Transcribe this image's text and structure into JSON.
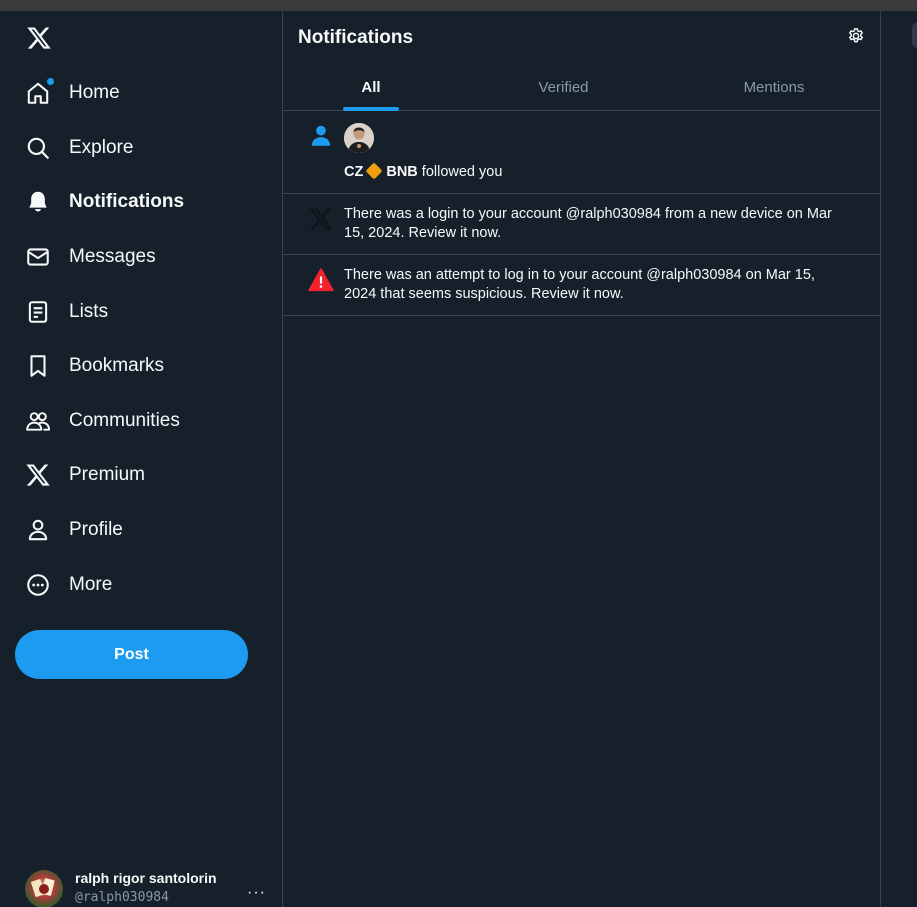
{
  "sidebar": {
    "logo_icon": "x-logo-icon",
    "items": [
      {
        "label": "Home",
        "icon": "home-icon",
        "active": false,
        "has_dot": true
      },
      {
        "label": "Explore",
        "icon": "search-icon",
        "active": false
      },
      {
        "label": "Notifications",
        "icon": "bell-icon",
        "active": true
      },
      {
        "label": "Messages",
        "icon": "envelope-icon",
        "active": false
      },
      {
        "label": "Lists",
        "icon": "list-icon",
        "active": false
      },
      {
        "label": "Bookmarks",
        "icon": "bookmark-icon",
        "active": false
      },
      {
        "label": "Communities",
        "icon": "people-icon",
        "active": false
      },
      {
        "label": "Premium",
        "icon": "x-logo-icon",
        "active": false
      },
      {
        "label": "Profile",
        "icon": "person-icon",
        "active": false
      },
      {
        "label": "More",
        "icon": "more-circle-icon",
        "active": false
      }
    ],
    "post_label": "Post",
    "account": {
      "name": "ralph rigor santolorin",
      "handle": "@ralph030984",
      "more": "···"
    }
  },
  "main": {
    "title": "Notifications",
    "settings_icon": "gear-icon",
    "tabs": [
      {
        "label": "All",
        "active": true
      },
      {
        "label": "Verified",
        "active": false
      },
      {
        "label": "Mentions",
        "active": false
      }
    ],
    "notifications": [
      {
        "type": "follow",
        "icon": "person-icon",
        "user_1": "CZ",
        "user_2": "BNB",
        "action": "followed you"
      },
      {
        "type": "login",
        "icon": "x-logo-icon",
        "text": "There was a login to your account @ralph030984 from a new device on Mar 15, 2024. Review it now."
      },
      {
        "type": "alert",
        "icon": "warning-icon",
        "text": "There was an attempt to log in to your account @ralph030984 on Mar 15, 2024 that seems suspicious. Review it now."
      }
    ]
  },
  "colors": {
    "background": "#15202b",
    "accent": "#1d9bf0",
    "border": "#38444d",
    "muted_text": "#8b98a5",
    "alert": "#f4212e",
    "badge": "#f0a00e"
  }
}
